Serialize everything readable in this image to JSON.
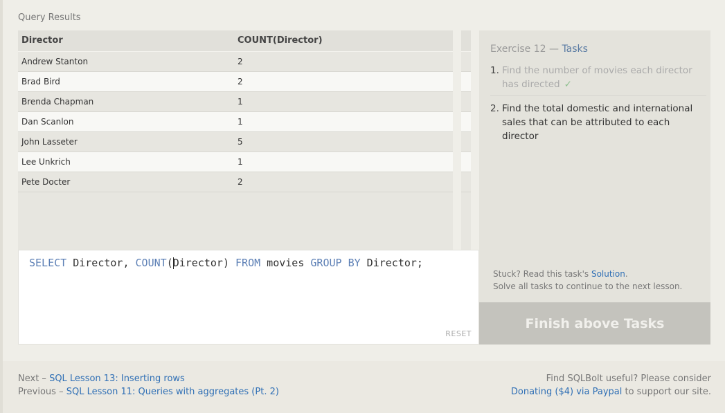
{
  "results": {
    "title": "Query Results",
    "columns": [
      "Director",
      "COUNT(Director)"
    ],
    "rows": [
      [
        "Andrew Stanton",
        "2"
      ],
      [
        "Brad Bird",
        "2"
      ],
      [
        "Brenda Chapman",
        "1"
      ],
      [
        "Dan Scanlon",
        "1"
      ],
      [
        "John Lasseter",
        "5"
      ],
      [
        "Lee Unkrich",
        "1"
      ],
      [
        "Pete Docter",
        "2"
      ]
    ]
  },
  "editor": {
    "kw_select": "SELECT",
    "part1": " Director, ",
    "fn_count": "COUNT",
    "paren_open": "(",
    "arg": "Director",
    "paren_close": ")",
    "space": " ",
    "kw_from": "FROM",
    "table": " movies ",
    "kw_group": "GROUP",
    "space2": " ",
    "kw_by": "BY",
    "tail": " Director;",
    "reset_label": "RESET"
  },
  "tasks": {
    "exercise_label": "Exercise 12",
    "separator": " — ",
    "tasks_label": "Tasks",
    "items": [
      {
        "num": "1.",
        "text": "Find the number of movies each director has directed",
        "check": "✓"
      },
      {
        "num": "2.",
        "text": "Find the total domestic and international sales that can be attributed to each director"
      }
    ],
    "stuck_prefix": "Stuck? Read this task's ",
    "solution_link": "Solution",
    "stuck_suffix": ".",
    "solve_all": "Solve all tasks to continue to the next lesson.",
    "finish_button": "Finish above Tasks"
  },
  "footer": {
    "next_prefix": "Next – ",
    "next_link": "SQL Lesson 13: Inserting rows",
    "prev_prefix": "Previous – ",
    "prev_link": "SQL Lesson 11: Queries with aggregates (Pt. 2)",
    "useful": "Find SQLBolt useful? Please consider",
    "donate_link": "Donating ($4) via Paypal",
    "support": " to support our site."
  },
  "colors": {
    "accent_link": "#2f6fb5",
    "keyword": "#5c7fb5",
    "check": "#8fc08f"
  }
}
